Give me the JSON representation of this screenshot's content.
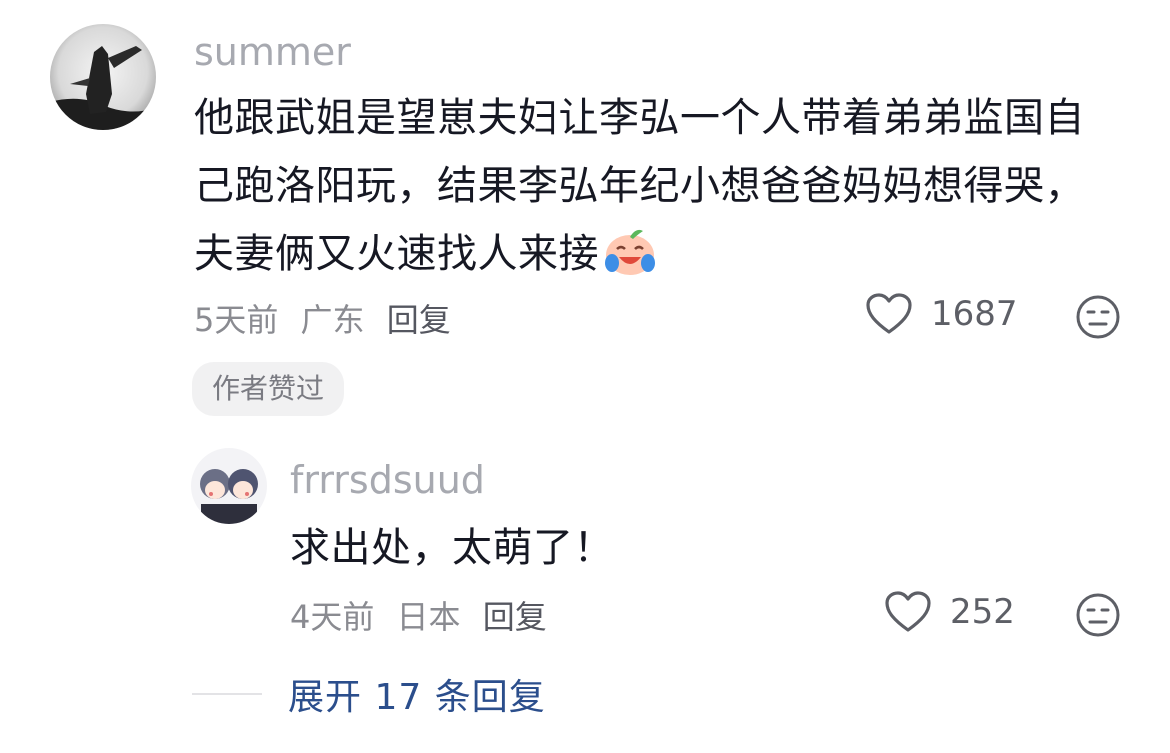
{
  "comment": {
    "username": "summer",
    "text": "他跟武姐是望崽夫妇让李弘一个人带着弟弟监国自己跑洛阳玩，结果李弘年纪小想爸爸妈妈想得哭，夫妻俩又火速找人来接",
    "emoji": "crying-laughing-peach-emoji",
    "time": "5天前",
    "location": "广东",
    "reply_label": "回复",
    "like_count": "1687",
    "author_liked_label": "作者赞过"
  },
  "reply": {
    "username": "frrrsdsuud",
    "text": "求出处，太萌了！",
    "time": "4天前",
    "location": "日本",
    "reply_label": "回复",
    "like_count": "252"
  },
  "expand": {
    "label": "展开 17 条回复"
  },
  "icons": {
    "like": "heart-outline-icon",
    "dislike": "meh-face-icon"
  },
  "colors": {
    "text": "#161823",
    "username": "#a7a9b0",
    "meta": "#8a8b91",
    "link": "#2b4e8c"
  }
}
